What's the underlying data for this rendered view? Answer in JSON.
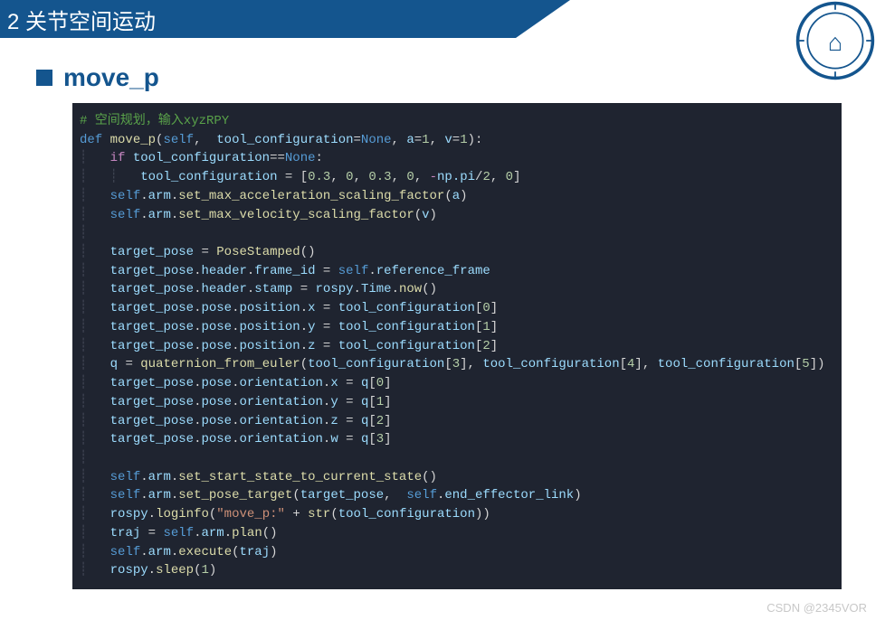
{
  "header": {
    "title": "2 关节空间运动"
  },
  "section": {
    "title": "move_p"
  },
  "watermark": "CSDN @2345VOR",
  "code": {
    "c0": "# 空间规划，输入xyzRPY",
    "kw_def": "def",
    "fn_name": "move_p",
    "p_self": "self",
    "p_tool": "tool_configuration",
    "kw_none": "None",
    "p_a": "a",
    "n1": "1",
    "p_v": "v",
    "kw_if": "if",
    "eqeq": "==",
    "n03a": "0.3",
    "n0a": "0",
    "n03b": "0.3",
    "n0b": "0",
    "pi_np": "np.pi",
    "slash2": "/",
    "n2a": "2",
    "n0c": "0",
    "selfarm": "self",
    "dot": ".",
    "arm": "arm",
    "fn_setacc": "set_max_acceleration_scaling_factor",
    "fn_setvel": "set_max_velocity_scaling_factor",
    "tp": "target_pose",
    "PoseStamped": "PoseStamped",
    "header": "header",
    "frame_id": "frame_id",
    "ref": "reference_frame",
    "stamp": "stamp",
    "rospy": "rospy",
    "Time": "Time",
    "now": "now",
    "pose": "pose",
    "position": "position",
    "x": "x",
    "y": "y",
    "z": "z",
    "w": "w",
    "tc": "tool_configuration",
    "i0": "0",
    "i1": "1",
    "i2": "2",
    "i3": "3",
    "i4": "4",
    "i5": "5",
    "q": "q",
    "qfn": "quaternion_from_euler",
    "orientation": "orientation",
    "fn_sss": "set_start_state_to_current_state",
    "fn_spt": "set_pose_target",
    "eel": "end_effector_link",
    "loginfo": "loginfo",
    "str_movep": "\"move_p:\"",
    "plus": "+",
    "str": "str",
    "traj": "traj",
    "plan": "plan",
    "execute": "execute",
    "sleep": "sleep",
    "n1b": "1"
  }
}
